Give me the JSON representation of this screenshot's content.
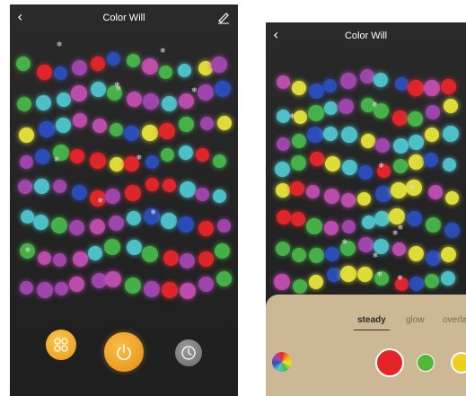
{
  "screen1": {
    "title": "Color Will",
    "back_glyph": "‹",
    "icons": {
      "back": "chevron-left-icon",
      "edit": "pencil-icon",
      "scene": "grid-icon",
      "power": "power-icon",
      "timer": "timer-icon",
      "snowflake": "snowflake-icon"
    }
  },
  "screen2": {
    "title": "Color Will",
    "back_glyph": "‹",
    "modes": [
      {
        "label": "steady",
        "active": true
      },
      {
        "label": "glow",
        "active": false
      },
      {
        "label": "overla",
        "active": false
      }
    ],
    "swatches": [
      {
        "name": "rainbow-wheel",
        "color": "rainbow"
      },
      {
        "name": "red",
        "color": "#e42427",
        "selected": true
      },
      {
        "name": "green",
        "color": "#53b83a"
      },
      {
        "name": "yellow",
        "color": "#ecd11e"
      }
    ]
  },
  "colors": {
    "red": "#e8262b",
    "blue": "#2c4fbe",
    "yellow": "#e8e63a",
    "green": "#48b84b",
    "cyan": "#4fc8d0",
    "purple": "#a547b3",
    "magenta": "#c44fb3",
    "accent": "#f0a623"
  }
}
